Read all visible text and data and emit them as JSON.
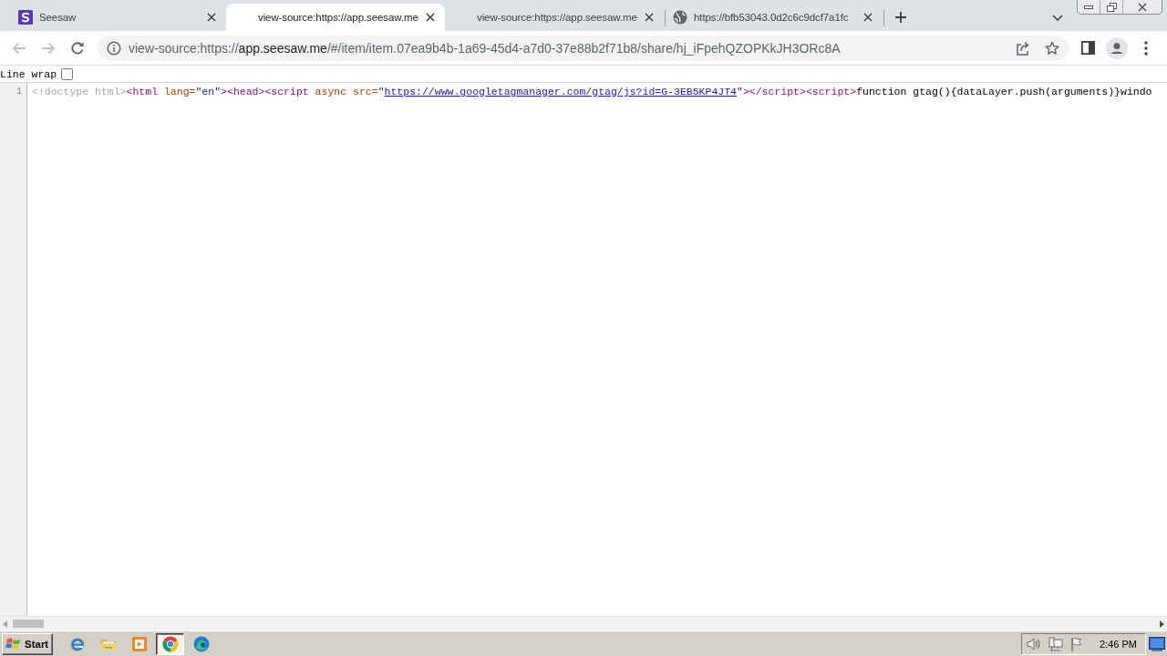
{
  "tabs": [
    {
      "kind": "app",
      "title": "Seesaw",
      "selected": false
    },
    {
      "kind": "blank",
      "title": "view-source:https://app.seesaw.me",
      "selected": true
    },
    {
      "kind": "blank",
      "title": "view-source:https://app.seesaw.me",
      "selected": false
    },
    {
      "kind": "web",
      "title": "https://bfb53043.0d2c6c9dcf7a1fc",
      "selected": false
    }
  ],
  "toolbar": {
    "back_disabled": true,
    "forward_disabled": true
  },
  "address_bar": {
    "scheme": "view-source:https://",
    "host": "app.seesaw.me",
    "path": "/#/item/item.07ea9b4b-1a69-45d4-a7d0-37e88b2f71b8/share/hj_iFpehQZOPKkJH3ORc8A"
  },
  "line_wrap": {
    "label": "Line wrap",
    "checked": false
  },
  "source": {
    "lines": [
      {
        "number": "1",
        "tokens": [
          {
            "kind": "doctype",
            "text": "<!doctype html>"
          },
          {
            "kind": "tag",
            "text": "<html"
          },
          {
            "kind": "attr",
            "text": " lang="
          },
          {
            "kind": "value",
            "text": "\"en\""
          },
          {
            "kind": "tag",
            "text": "><head><script"
          },
          {
            "kind": "attr",
            "text": " async src="
          },
          {
            "kind": "value",
            "text": "\""
          },
          {
            "kind": "link",
            "text": "https://www.googletagmanager.com/gtag/js?id=G-3EB5KP4JT4"
          },
          {
            "kind": "value",
            "text": "\""
          },
          {
            "kind": "tag",
            "text": "></script><script>"
          },
          {
            "kind": "text",
            "text": "function gtag(){dataLayer.push(arguments)}windo"
          }
        ]
      }
    ]
  },
  "taskbar": {
    "start": "Start",
    "apps": [
      {
        "kind": "ie",
        "selected": false
      },
      {
        "kind": "folder",
        "selected": false
      },
      {
        "kind": "media",
        "selected": false
      },
      {
        "kind": "chrome",
        "selected": true
      },
      {
        "kind": "edge",
        "selected": false
      }
    ],
    "clock": "2:46 PM"
  }
}
